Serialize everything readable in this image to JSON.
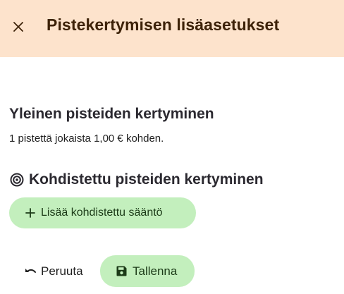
{
  "header": {
    "close_icon": "close-icon",
    "title": "Pistekertymisen lisäasetukset",
    "background": "#fde3cc",
    "title_color": "#3d2208"
  },
  "general": {
    "title": "Yleinen pisteiden kertyminen",
    "description": "1 pistettä jokaista 1,00 € kohden."
  },
  "targeted": {
    "icon": "target-icon",
    "title": "Kohdistettu pisteiden kertyminen",
    "add_rule_label": "Lisää kohdistettu sääntö",
    "add_rule_icon": "plus-icon"
  },
  "actions": {
    "cancel_label": "Peruuta",
    "cancel_icon": "undo-icon",
    "save_label": "Tallenna",
    "save_icon": "save-icon",
    "button_color": "#c3efbd"
  }
}
